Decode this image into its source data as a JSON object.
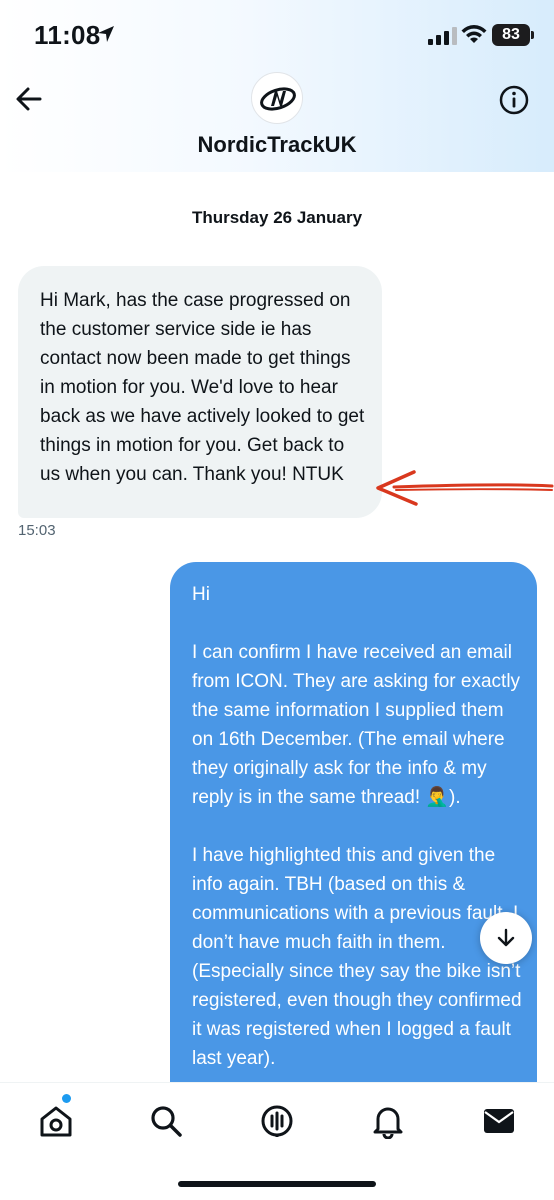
{
  "status_bar": {
    "time": "11:08",
    "battery": "83",
    "icons": [
      "location-arrow-icon",
      "cellular-signal-icon",
      "wifi-icon",
      "battery-icon"
    ]
  },
  "header": {
    "back_icon": "arrow-left-icon",
    "contact_name": "NordicTrackUK",
    "avatar_icon": "nordictrack-logo",
    "info_icon": "info-circle-icon"
  },
  "conversation": {
    "date_divider": "Thursday 26 January",
    "messages": [
      {
        "direction": "incoming",
        "text": "Hi Mark, has the case progressed on the customer service side ie has contact now been made to get things in motion for you. We'd love to hear back as we have actively looked to get things in motion for you. Get back to us when you can. Thank you! NTUK",
        "time": "15:03"
      },
      {
        "direction": "outgoing",
        "text": "Hi\n\nI can confirm I have received an email from ICON. They are asking for exactly the same information I supplied them on 16th December. (The email where they originally ask for the info & my reply is in the same thread! 🤦‍♂️).\n\nI have highlighted this and given the info again. TBH (based on this & communications with a previous fault, I don’t have much faith in them. (Especially since they say the bike isn’t registered, even though they confirmed it was registered when I logged a fault last year)."
      }
    ]
  },
  "annotation": {
    "arrow_color": "#d9381e"
  },
  "scroll_button_icon": "arrow-down-icon",
  "tab_bar": {
    "tabs": [
      {
        "name": "home",
        "icon": "home-icon",
        "has_notification_dot": true
      },
      {
        "name": "search",
        "icon": "search-icon"
      },
      {
        "name": "spaces",
        "icon": "spaces-microphone-icon"
      },
      {
        "name": "notifications",
        "icon": "bell-icon"
      },
      {
        "name": "messages",
        "icon": "envelope-icon",
        "active": true
      }
    ]
  },
  "colors": {
    "accent": "#1d9bf0",
    "outgoing_bubble": "#4a97e6",
    "incoming_bubble": "#eff3f4"
  }
}
